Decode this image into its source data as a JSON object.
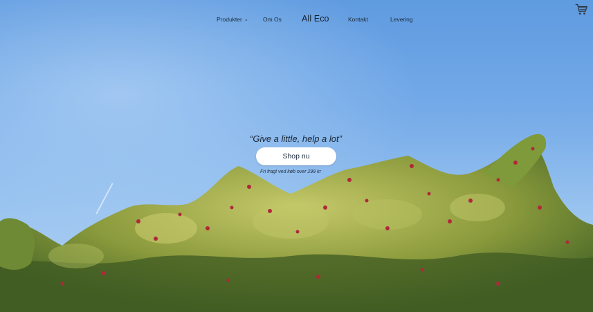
{
  "nav": {
    "products_label": "Produkter",
    "about_label": "Om Os",
    "brand": "All Eco",
    "contact_label": "Kontakt",
    "delivery_label": "Levering",
    "cart_icon": "cart-icon"
  },
  "hero": {
    "tagline": "“Give a little, help a lot”",
    "cta_label": "Shop nu",
    "shipping_note": "Fri fragt ved køb over 299 kr"
  },
  "colors": {
    "sky_top": "#5f9be0",
    "sky_bottom": "#b5d4f3",
    "text": "#1d2a38",
    "button_bg": "#ffffff"
  }
}
